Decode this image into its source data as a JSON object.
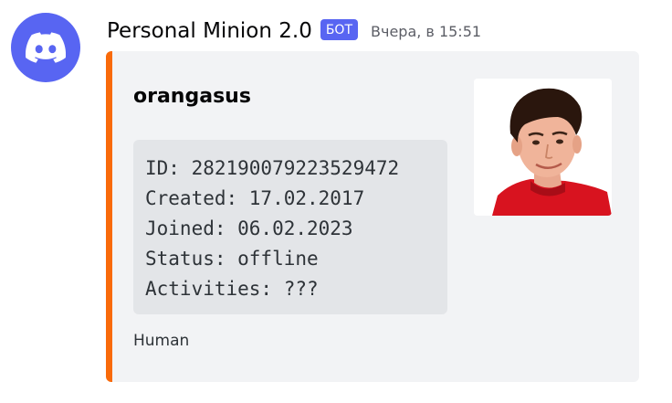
{
  "message": {
    "author": "Personal Minion 2.0",
    "bot_tag": "БОТ",
    "timestamp": "Вчера, в 15:51",
    "avatar_icon": "discord-logo-icon",
    "avatar_color": "#5865F2"
  },
  "embed": {
    "accent_color": "#f96a0a",
    "title": "orangasus",
    "code_lines": [
      "ID: 282190079223529472",
      "Created: 17.02.2017",
      "Joined: 06.02.2023",
      "Status: offline",
      "Activities: ???"
    ],
    "footer": "Human",
    "thumbnail": "user-avatar-photo"
  }
}
